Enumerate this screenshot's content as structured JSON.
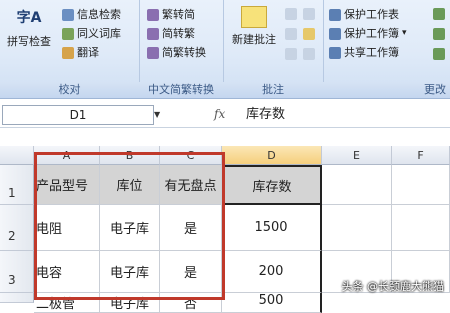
{
  "ribbon": {
    "groups": [
      {
        "title": "校对"
      },
      {
        "title": "中文简繁转换"
      },
      {
        "title": "批注"
      },
      {
        "title": "更改"
      }
    ],
    "proof": {
      "spell_check": "拼写检查",
      "spell_icon_text": "字A",
      "research": "信息检索",
      "thesaurus": "同义词库",
      "translate": "翻译"
    },
    "chinese": {
      "to_simplified": "繁转简",
      "to_traditional": "简转繁",
      "convert": "简繁转换"
    },
    "comments": {
      "new_comment": "新建批注"
    },
    "changes": {
      "protect_sheet": "保护工作表",
      "protect_workbook": "保护工作簿",
      "share_workbook": "共享工作簿",
      "dropdown_arrow": "▾"
    }
  },
  "formula_bar": {
    "name_box": "D1",
    "fx": "fx",
    "value": "库存数"
  },
  "grid": {
    "columns": [
      "A",
      "B",
      "C",
      "D",
      "E",
      "F"
    ],
    "rows": [
      "1",
      "2",
      "3"
    ],
    "header_row": [
      "产品型号",
      "库位",
      "有无盘点",
      "库存数"
    ],
    "data": [
      [
        "电阻",
        "电子库",
        "是",
        "1500"
      ],
      [
        "电容",
        "电子库",
        "是",
        "200"
      ],
      [
        "二极管",
        "电子库",
        "否",
        "500"
      ]
    ]
  },
  "watermark": "头条 @长颈鹿大熊猫",
  "colors": {
    "highlight_border": "#c0392b",
    "header_fill": "#d4d4d4",
    "ribbon_bg": "#dfeaf8"
  }
}
